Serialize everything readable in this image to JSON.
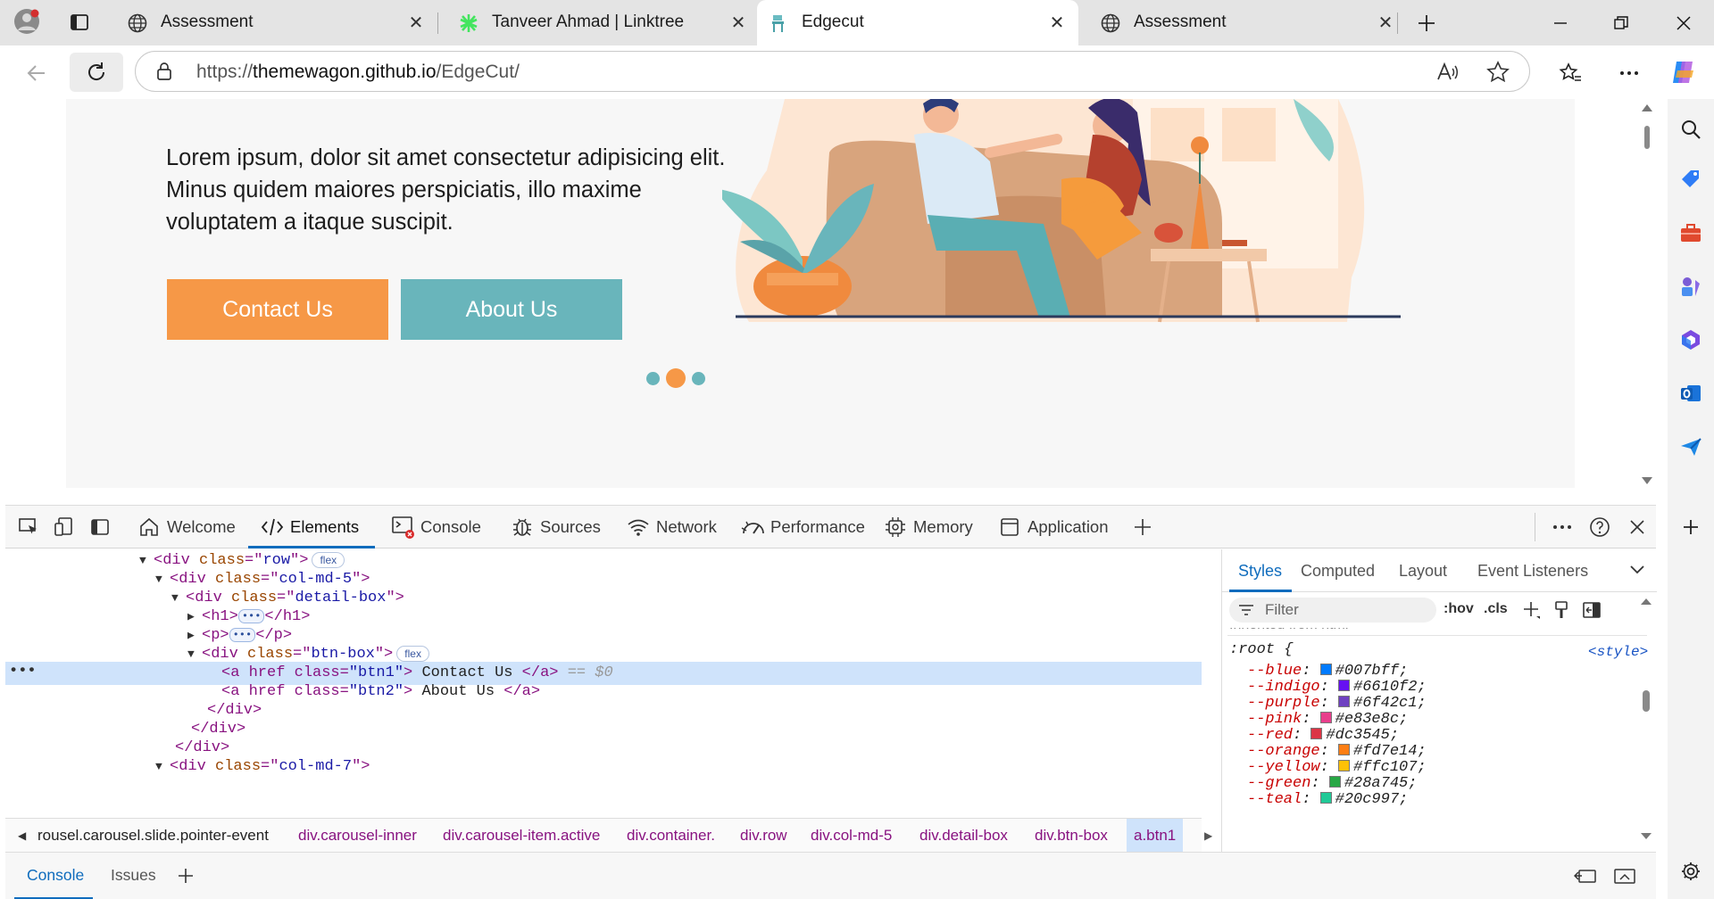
{
  "browser": {
    "tabs": [
      {
        "title": "Assessment",
        "active": false
      },
      {
        "title": "Tanveer Ahmad | Linktree",
        "active": false
      },
      {
        "title": "Edgecut",
        "active": true
      },
      {
        "title": "Assessment",
        "active": false
      }
    ],
    "url_prefix": "https://",
    "url_host": "themewagon.github.io",
    "url_path": "/EdgeCut/"
  },
  "page": {
    "hero_text": "Lorem ipsum, dolor sit amet consectetur adipisicing elit. Minus quidem maiores perspiciatis, illo maxime voluptatem a itaque suscipit.",
    "contact_button": "Contact Us",
    "about_button": "About Us",
    "carousel_active_index": 2,
    "carousel_dot_count": 3,
    "colors": {
      "orange": "#f69847",
      "teal": "#69b5bb",
      "hero_bg": "#f7f7f7"
    }
  },
  "devtools": {
    "tabs": [
      "Welcome",
      "Elements",
      "Console",
      "Sources",
      "Network",
      "Performance",
      "Memory",
      "Application"
    ],
    "active_tab": "Elements",
    "dom": {
      "l1": {
        "tag": "div",
        "attr": "class",
        "val": "row",
        "badge": "flex"
      },
      "l2": {
        "tag": "div",
        "attr": "class",
        "val": "col-md-5"
      },
      "l3": {
        "tag": "div",
        "attr": "class",
        "val": "detail-box"
      },
      "l4": {
        "open": "<h1>",
        "close": "</h1>"
      },
      "l5": {
        "open": "<p>",
        "close": "</p>"
      },
      "l6": {
        "tag": "div",
        "attr": "class",
        "val": "btn-box",
        "badge": "flex"
      },
      "l7": {
        "pre": "<a href class=",
        "val": "\"btn1\"",
        "post": ">",
        "text": " Contact Us ",
        "close": "</a>",
        "marker": "== $0"
      },
      "l8": {
        "pre": "<a href class=",
        "val": "\"btn2\"",
        "post": ">",
        "text": " About Us ",
        "close": "</a>"
      },
      "l9": "</div>",
      "l10": "</div>",
      "l11": "</div>",
      "l12": {
        "tag": "div",
        "attr": "class",
        "val": "col-md-7"
      }
    },
    "breadcrumbs": [
      "rousel.carousel.slide.pointer-event",
      "div.carousel-inner",
      "div.carousel-item.active",
      "div.container.",
      "div.row",
      "div.col-md-5",
      "div.detail-box",
      "div.btn-box",
      "a.btn1"
    ],
    "styles_tabs": [
      "Styles",
      "Computed",
      "Layout",
      "Event Listeners"
    ],
    "filter_placeholder": "Filter",
    "hov": ":hov",
    "cls": ".cls",
    "inherited_label": "Inherited from html",
    "root_selector": ":root {",
    "root_source": "<style>",
    "css_vars": [
      {
        "name": "--blue",
        "value": "#007bff"
      },
      {
        "name": "--indigo",
        "value": "#6610f2"
      },
      {
        "name": "--purple",
        "value": "#6f42c1"
      },
      {
        "name": "--pink",
        "value": "#e83e8c"
      },
      {
        "name": "--red",
        "value": "#dc3545"
      },
      {
        "name": "--orange",
        "value": "#fd7e14"
      },
      {
        "name": "--yellow",
        "value": "#ffc107"
      },
      {
        "name": "--green",
        "value": "#28a745"
      },
      {
        "name": "--teal",
        "value": "#20c997"
      }
    ],
    "drawer_tabs": [
      "Console",
      "Issues"
    ]
  }
}
